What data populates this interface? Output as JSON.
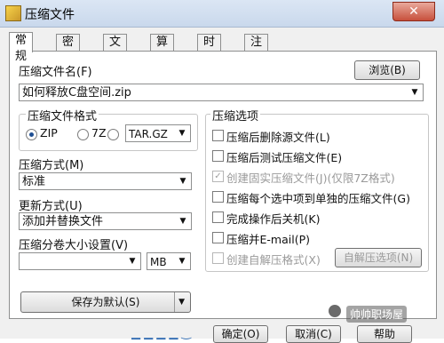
{
  "window": {
    "title": "压缩文件",
    "close_glyph": "✕"
  },
  "tabs": [
    "常规",
    "密码",
    "文件",
    "算法",
    "时间",
    "注释"
  ],
  "general": {
    "filename_label": "压缩文件名(F)",
    "browse_label": "浏览(B)",
    "filename_value": "如何释放C盘空间.zip",
    "format_group": "压缩文件格式",
    "formats": [
      "ZIP",
      "7Z",
      "TAR.GZ"
    ],
    "method_label": "压缩方式(M)",
    "method_value": "标准",
    "update_label": "更新方式(U)",
    "update_value": "添加并替换文件",
    "split_label": "压缩分卷大小设置(V)",
    "split_value": "",
    "split_unit": "MB",
    "save_default_label": "保存为默认(S)"
  },
  "options": {
    "group_title": "压缩选项",
    "items": [
      "压缩后删除源文件(L)",
      "压缩后测试压缩文件(E)",
      "创建固实压缩文件(J)(仅限7Z格式)",
      "压缩每个选中项到单独的压缩文件(G)",
      "完成操作后关机(K)",
      "压缩并E-mail(P)",
      "创建自解压格式(X)"
    ],
    "sfx_button": "自解压选项(N)"
  },
  "footer": {
    "ok_label": "确定(O)",
    "cancel_label": "取消(C)",
    "help_label": "帮助",
    "watermark": "帅帅职场屋"
  }
}
